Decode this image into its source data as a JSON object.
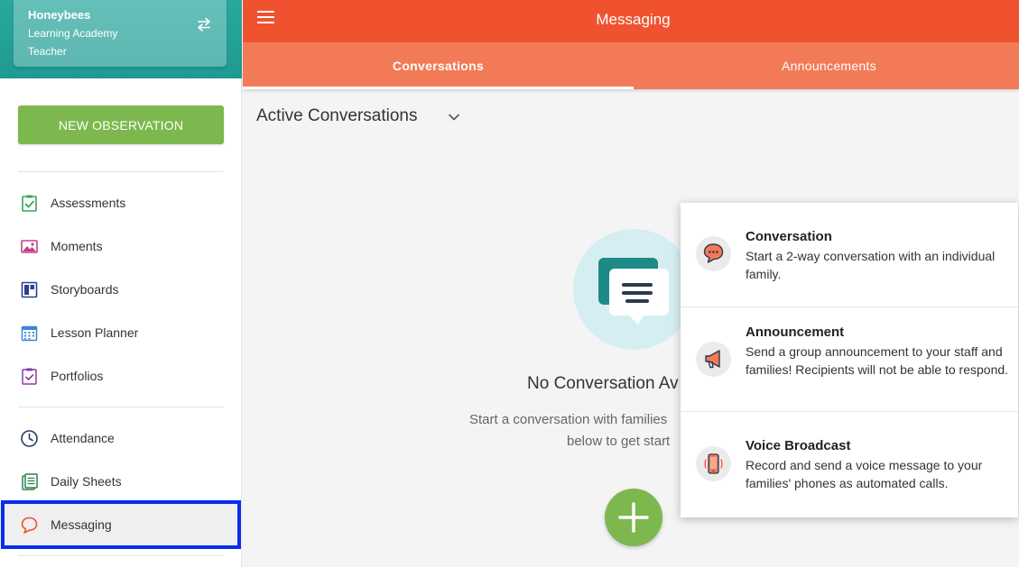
{
  "school": {
    "name": "Honeybees",
    "subtitle": "Learning Academy",
    "role": "Teacher"
  },
  "sidebar": {
    "new_observation_label": "NEW OBSERVATION",
    "items": [
      {
        "label": "Assessments",
        "icon": "assessments-icon"
      },
      {
        "label": "Moments",
        "icon": "moments-icon"
      },
      {
        "label": "Storyboards",
        "icon": "storyboards-icon"
      },
      {
        "label": "Lesson Planner",
        "icon": "calendar-icon"
      },
      {
        "label": "Portfolios",
        "icon": "portfolios-icon"
      },
      {
        "label": "Attendance",
        "icon": "clock-icon"
      },
      {
        "label": "Daily Sheets",
        "icon": "daily-sheets-icon"
      },
      {
        "label": "Messaging",
        "icon": "chat-bubble-icon",
        "active": true
      }
    ]
  },
  "header": {
    "title": "Messaging",
    "tabs": [
      {
        "label": "Conversations",
        "active": true
      },
      {
        "label": "Announcements",
        "active": false
      }
    ]
  },
  "main": {
    "section_title": "Active Conversations",
    "empty_title": "No Conversation Av",
    "empty_text_line1": "Start a conversation with families",
    "empty_text_line2": "below to get start"
  },
  "popover": {
    "items": [
      {
        "title": "Conversation",
        "description": "Start a 2-way conversation with an individual family.",
        "icon": "conversation-icon"
      },
      {
        "title": "Announcement",
        "description": "Send a group announcement to your staff and families! Recipients will not be able to respond.",
        "icon": "megaphone-icon"
      },
      {
        "title": "Voice Broadcast",
        "description": "Record and send a voice message to your families' phones as automated calls.",
        "icon": "phone-icon"
      }
    ]
  },
  "colors": {
    "brand_orange": "#f0522f",
    "tab_orange": "#f27a56",
    "teal": "#1f9a91",
    "green": "#7db84e",
    "focus_blue": "#0a2cf0"
  }
}
